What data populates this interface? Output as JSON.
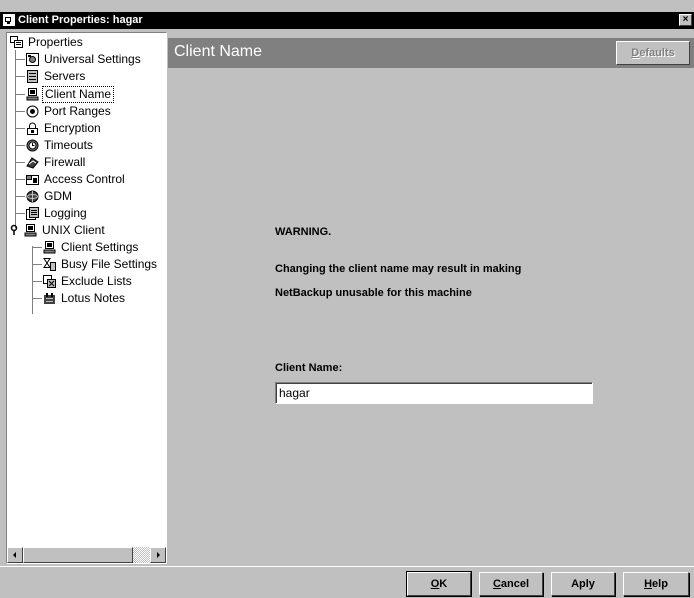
{
  "window": {
    "title": "Client Properties: hagar",
    "close_glyph": "×"
  },
  "tree": {
    "items": [
      {
        "label": "Properties",
        "icon": "properties-icon"
      },
      {
        "label": "Universal Settings",
        "icon": "universal-settings-icon"
      },
      {
        "label": "Servers",
        "icon": "servers-icon"
      },
      {
        "label": "Client Name",
        "icon": "client-name-icon",
        "selected": true
      },
      {
        "label": "Port Ranges",
        "icon": "port-ranges-icon"
      },
      {
        "label": "Encryption",
        "icon": "lock-icon"
      },
      {
        "label": "Timeouts",
        "icon": "clock-icon"
      },
      {
        "label": "Firewall",
        "icon": "firewall-icon"
      },
      {
        "label": "Access Control",
        "icon": "access-control-icon"
      },
      {
        "label": "GDM",
        "icon": "gdm-icon"
      },
      {
        "label": "Logging",
        "icon": "logging-icon"
      },
      {
        "label": "UNIX Client",
        "icon": "unix-client-icon",
        "expanded": true
      },
      {
        "label": "Client Settings",
        "icon": "client-settings-icon"
      },
      {
        "label": "Busy File Settings",
        "icon": "busy-file-icon"
      },
      {
        "label": "Exclude Lists",
        "icon": "exclude-lists-icon"
      },
      {
        "label": "Lotus Notes",
        "icon": "lotus-notes-icon"
      }
    ]
  },
  "panel": {
    "title": "Client Name",
    "defaults_label": "Defaults",
    "defaults_mnemonic": "D",
    "defaults_rest": "efaults",
    "warning_title": "WARNING.",
    "warning_line1": "Changing the client name may result in making",
    "warning_line2": "NetBackup unusable for this machine",
    "field_label": "Client Name:",
    "field_value": "hagar"
  },
  "buttons": {
    "ok_mnemonic": "O",
    "ok_rest": "K",
    "cancel_mnemonic": "C",
    "cancel_rest": "ancel",
    "apply_pre": "Ap",
    "apply_mnemonic": "p",
    "apply_post": "ly",
    "help_mnemonic": "H",
    "help_rest": "elp"
  },
  "colors": {
    "window_bg": "#c0c0c0",
    "title_bar": "#000000",
    "header_bg": "#808080",
    "header_text": "#ffffff"
  }
}
